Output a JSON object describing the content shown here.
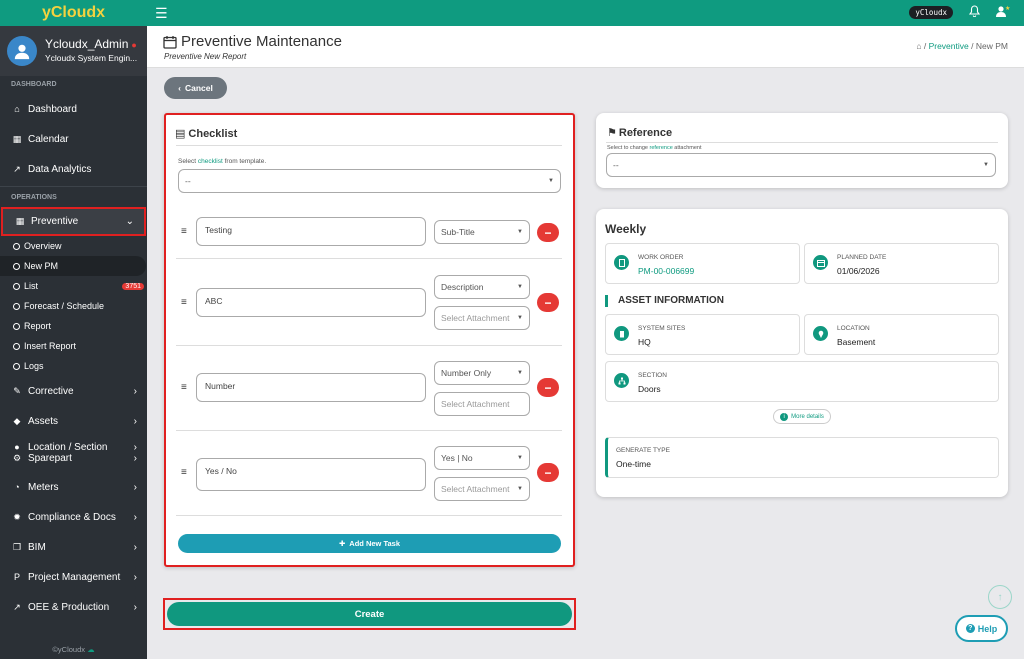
{
  "brand": "yCloudx",
  "user": {
    "name": "Ycloudx_Admin",
    "role": "Ycloudx System Engin..."
  },
  "sidebar": {
    "section_dashboard": "DASHBOARD",
    "dashboard": "Dashboard",
    "calendar": "Calendar",
    "analytics": "Data Analytics",
    "section_operations": "OPERATIONS",
    "preventive": "Preventive",
    "sub": [
      "Overview",
      "New PM",
      "List",
      "Forecast / Schedule",
      "Report",
      "Insert Report",
      "Logs"
    ],
    "list_badge": "3751",
    "corrective": "Corrective",
    "assets": "Assets",
    "location": "Location / Section",
    "sparepart": "Sparepart",
    "meters": "Meters",
    "compliance": "Compliance & Docs",
    "bim": "BIM",
    "project": "Project Management",
    "oee": "OEE & Production",
    "copyright": "©yCloudx"
  },
  "topbar": {
    "pill": "yCloudx"
  },
  "header": {
    "title": "Preventive Maintenance",
    "subtitle": "Preventive New Report",
    "crumb_link": "Preventive",
    "crumb_sep": "/",
    "crumb_current": "New PM"
  },
  "cancel_label": "Cancel",
  "checklist": {
    "title": "Checklist",
    "select_prefix": "Select ",
    "select_hl": "checklist",
    "select_suffix": " from template.",
    "select_value": "--",
    "tasks": [
      {
        "text": "Testing",
        "type": "Sub-Title"
      },
      {
        "text": "ABC",
        "type": "Description",
        "attach": "Select Attachment"
      },
      {
        "text": "Number",
        "type": "Number Only",
        "attach": "Select Attachment"
      },
      {
        "text": "Yes / No",
        "type": "Yes | No",
        "attach": "Select Attachment"
      }
    ],
    "add_label": "Add New Task"
  },
  "create_label": "Create",
  "reference": {
    "title": "Reference",
    "label_prefix": "Select to change ",
    "label_hl": "reference",
    "label_suffix": " attachment",
    "value": "--"
  },
  "weekly": {
    "title": "Weekly",
    "work_order_label": "WORK ORDER",
    "work_order": "PM-00-006699",
    "planned_label": "PLANNED DATE",
    "planned": "01/06/2026",
    "asset_header": "ASSET INFORMATION",
    "sites_label": "SYSTEM SITES",
    "sites": "HQ",
    "location_label": "LOCATION",
    "location": "Basement",
    "section_label": "SECTION",
    "section": "Doors",
    "more": "More details",
    "gen_label": "GENERATE TYPE",
    "gen": "One-time"
  },
  "help_label": "Help",
  "colors": {
    "teal": "#0f9b80",
    "sidebar": "#2b3036",
    "danger": "#e53935",
    "highlight": "#e02020",
    "info": "#1e9db4"
  }
}
